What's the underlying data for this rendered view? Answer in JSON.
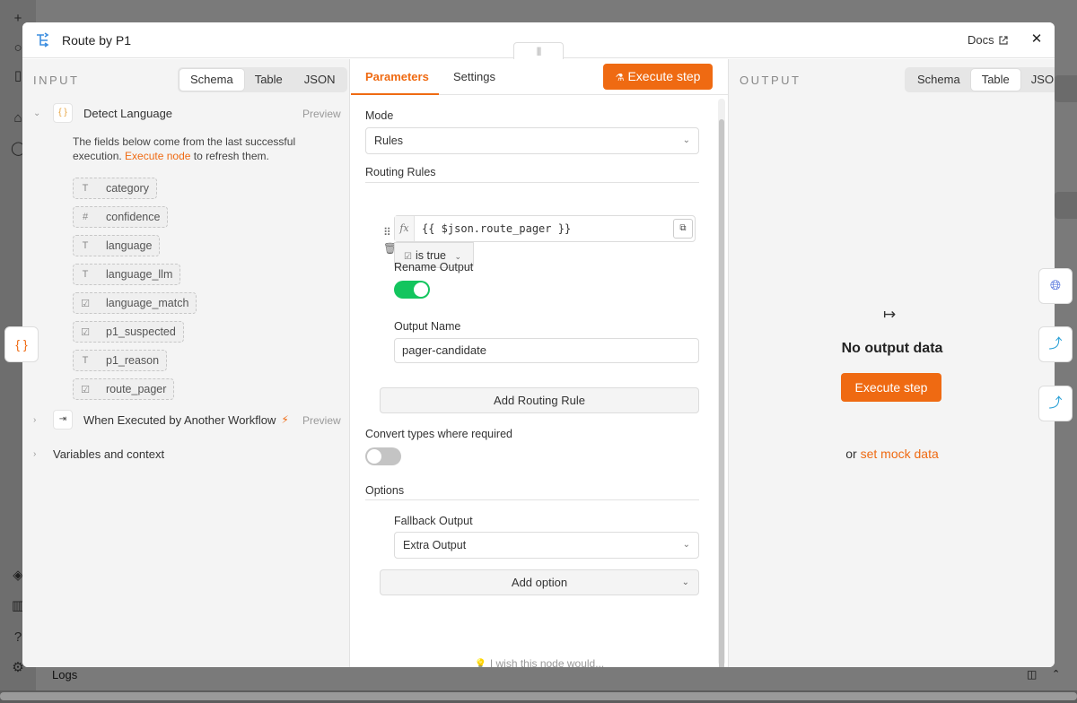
{
  "background": {
    "logs_label": "Logs"
  },
  "modal": {
    "title": "Route by P1",
    "docs_label": "Docs"
  },
  "input_panel": {
    "heading": "INPUT",
    "view_tabs": [
      "Schema",
      "Table",
      "JSON"
    ],
    "active_view": "Schema",
    "node1": {
      "name": "Detect Language",
      "preview_label": "Preview",
      "help_text_before": "The fields below come from the last successful execution.",
      "help_link": "Execute node",
      "help_text_after": "to refresh them.",
      "fields": [
        {
          "name": "category",
          "type_icon": "T"
        },
        {
          "name": "confidence",
          "type_icon": "#"
        },
        {
          "name": "language",
          "type_icon": "T"
        },
        {
          "name": "language_llm",
          "type_icon": "T"
        },
        {
          "name": "language_match",
          "type_icon": "☑"
        },
        {
          "name": "p1_suspected",
          "type_icon": "☑"
        },
        {
          "name": "p1_reason",
          "type_icon": "T"
        },
        {
          "name": "route_pager",
          "type_icon": "☑"
        }
      ]
    },
    "node2": {
      "name": "When Executed by Another Workflow",
      "preview_label": "Preview"
    },
    "variables_label": "Variables and context"
  },
  "params_panel": {
    "tabs": [
      "Parameters",
      "Settings"
    ],
    "active_tab": "Parameters",
    "execute_label": "Execute step",
    "mode_label": "Mode",
    "mode_value": "Rules",
    "routing_rules_label": "Routing Rules",
    "rule": {
      "expression": "{{ $json.route_pager }}",
      "condition": "is true",
      "rename_output_label": "Rename Output",
      "rename_output_on": true,
      "output_name_label": "Output Name",
      "output_name_value": "pager-candidate"
    },
    "add_rule_label": "Add Routing Rule",
    "convert_types_label": "Convert types where required",
    "convert_types_on": false,
    "options_label": "Options",
    "fallback_label": "Fallback Output",
    "fallback_value": "Extra Output",
    "add_option_label": "Add option",
    "wish_label": "I wish this node would..."
  },
  "output_panel": {
    "heading": "OUTPUT",
    "view_tabs": [
      "Schema",
      "Table",
      "JSON"
    ],
    "active_view": "Table",
    "no_data_label": "No output data",
    "execute_label": "Execute step",
    "or_label": "or",
    "mock_link": "set mock data"
  },
  "colors": {
    "accent": "#ef6a12",
    "toggle_on": "#13c55e",
    "toggle_off": "#c4c4c4",
    "node_icon": "#3b8de0"
  }
}
